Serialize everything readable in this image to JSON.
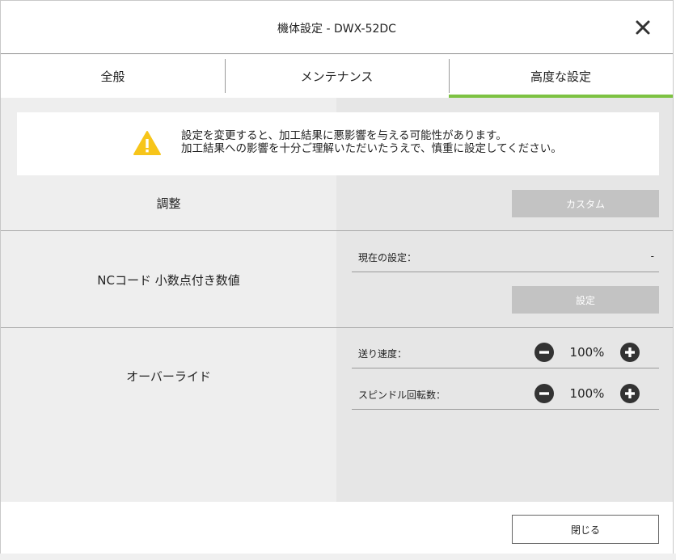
{
  "window": {
    "title": "機体設定 - DWX-52DC"
  },
  "tabs": [
    {
      "label": "全般",
      "active": false
    },
    {
      "label": "メンテナンス",
      "active": false
    },
    {
      "label": "高度な設定",
      "active": true
    }
  ],
  "warning": {
    "line1": "設定を変更すると、加工結果に悪影響を与える可能性があります。",
    "line2": "加工結果への影響を十分ご理解いただいたうえで、慎重に設定してください。"
  },
  "sections": {
    "adjust": {
      "label": "調整",
      "button": "カスタム"
    },
    "nc_code": {
      "label": "NCコード 小数点付き数値",
      "current_label": "現在の設定：",
      "current_value": "-",
      "button": "設定"
    },
    "override": {
      "label": "オーバーライド",
      "feed_label": "送り速度：",
      "feed_value": "100%",
      "spindle_label": "スピンドル回転数：",
      "spindle_value": "100%"
    }
  },
  "footer": {
    "close_label": "閉じる"
  },
  "colors": {
    "accent": "#7dc242",
    "warning_yellow": "#f7c51a",
    "disabled_button": "#c3c3c3"
  },
  "icons": {
    "close": "close-icon",
    "warning": "warning-icon",
    "minus": "minus-circle-icon",
    "plus": "plus-circle-icon"
  }
}
